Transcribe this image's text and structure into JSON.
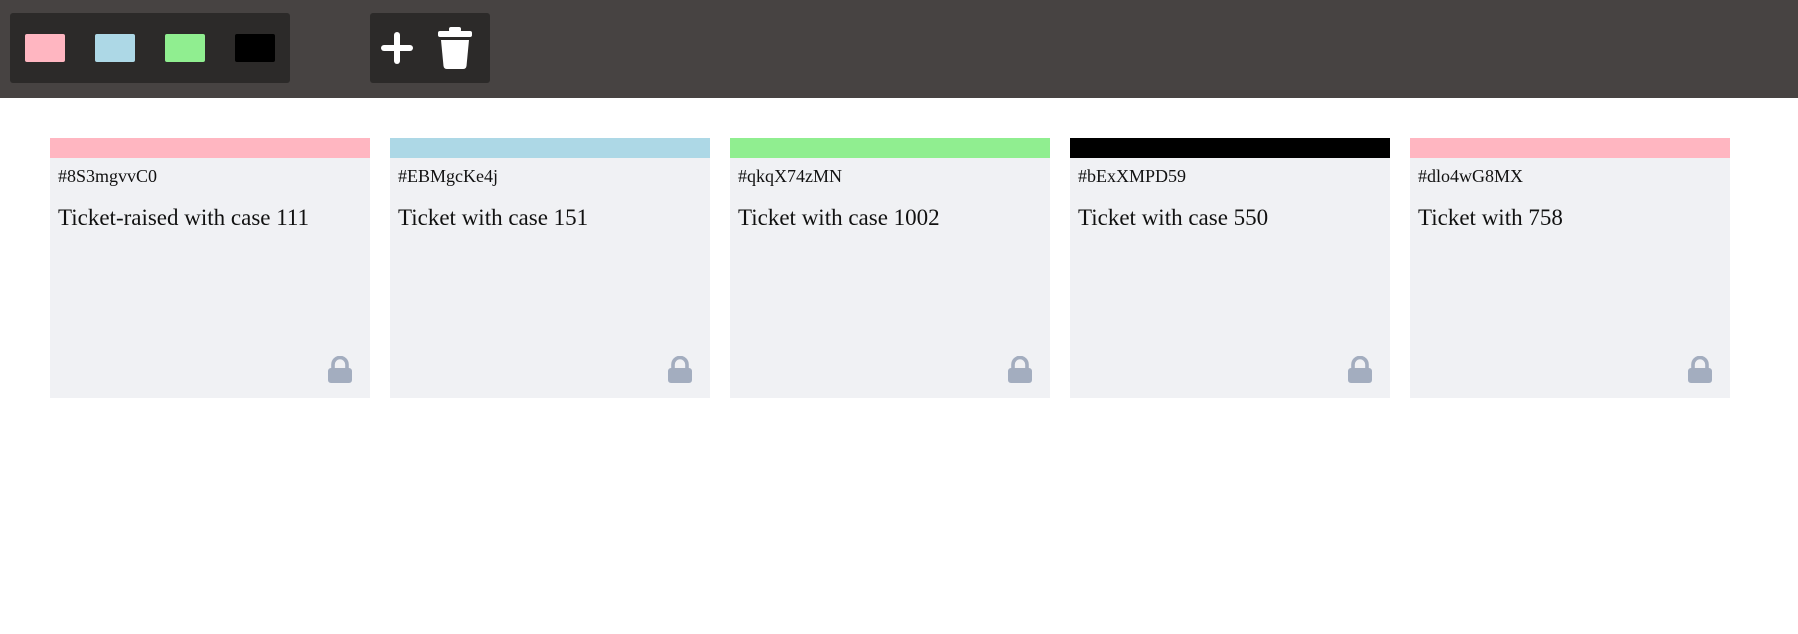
{
  "colors": {
    "pink": "#ffb6c1",
    "blue": "#add8e6",
    "green": "#90ee90",
    "black": "#000000",
    "lock": "#a3adbf"
  },
  "toolbar": {
    "swatches": [
      {
        "name": "pink",
        "color": "#ffb6c1"
      },
      {
        "name": "lightblue",
        "color": "#add8e6"
      },
      {
        "name": "lightgreen",
        "color": "#90ee90"
      },
      {
        "name": "black",
        "color": "#000000"
      }
    ],
    "actions": [
      {
        "icon": "plus-icon"
      },
      {
        "icon": "trash-icon"
      }
    ]
  },
  "tickets": [
    {
      "id": "#8S3mgvvC0",
      "text": "Ticket-raised with case 111",
      "color": "#ffb6c1",
      "icon": "lock-icon"
    },
    {
      "id": "#EBMgcKe4j",
      "text": "Ticket with case 151",
      "color": "#add8e6",
      "icon": "lock-icon"
    },
    {
      "id": "#qkqX74zMN",
      "text": "Ticket with case 1002",
      "color": "#90ee90",
      "icon": "lock-icon"
    },
    {
      "id": "#bExXMPD59",
      "text": "Ticket with case 550",
      "color": "#000000",
      "icon": "lock-icon"
    },
    {
      "id": "#dlo4wG8MX",
      "text": "Ticket with 758",
      "color": "#ffb6c1",
      "icon": "lock-icon"
    }
  ]
}
